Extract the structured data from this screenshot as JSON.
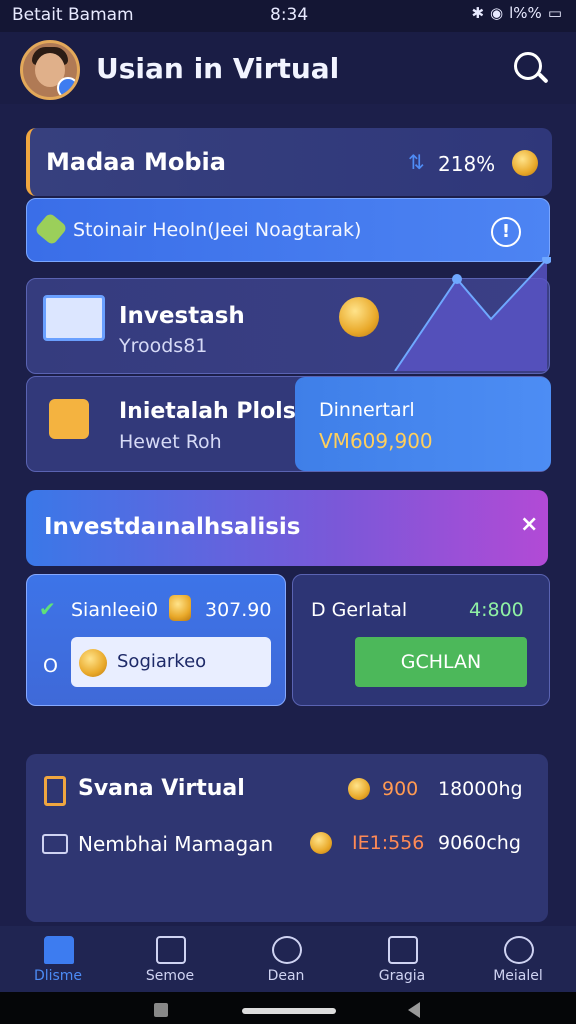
{
  "status": {
    "carrier": "Betait Bamam",
    "time": "8:34",
    "battery": "l%%"
  },
  "header": {
    "title": "Usian in Virtual"
  },
  "card1": {
    "title": "Madaa Mobia",
    "value": "218%"
  },
  "card2": {
    "text": "Stoinair Heoln(Jeei Noagtarak)",
    "info": "!"
  },
  "card3": {
    "title": "Investash",
    "subtitle": "Yroods81"
  },
  "card4": {
    "title": "Inietalah Plols",
    "subtitle": "Hewet Roh",
    "panel_label": "Dinnertarl",
    "panel_value": "VM609,900"
  },
  "banner": {
    "title": "Investdaınalhsalisis",
    "close": "×"
  },
  "left_panel": {
    "label": "Sianleei0",
    "value": "307.90",
    "o": "O",
    "button": "Sogiarkeo"
  },
  "right_panel": {
    "label": "D Gerlatal",
    "value": "4:800",
    "button": "GCHLAN"
  },
  "list": {
    "row1": {
      "label": "Svana Virtual",
      "amount": "900",
      "total": "18000hg"
    },
    "row2": {
      "label": "Nembhai Mamagan",
      "amount": "IE1:556",
      "total": "9060chg"
    }
  },
  "nav": [
    {
      "label": "Dlisme",
      "icon": "home-icon"
    },
    {
      "label": "Semoe",
      "icon": "list-icon"
    },
    {
      "label": "Dean",
      "icon": "search-icon"
    },
    {
      "label": "Gragia",
      "icon": "image-icon"
    },
    {
      "label": "Meialel",
      "icon": "download-icon"
    }
  ],
  "colors": {
    "accent": "#3d7cf0",
    "positive": "#4cb85a",
    "warning": "#f0a640"
  }
}
